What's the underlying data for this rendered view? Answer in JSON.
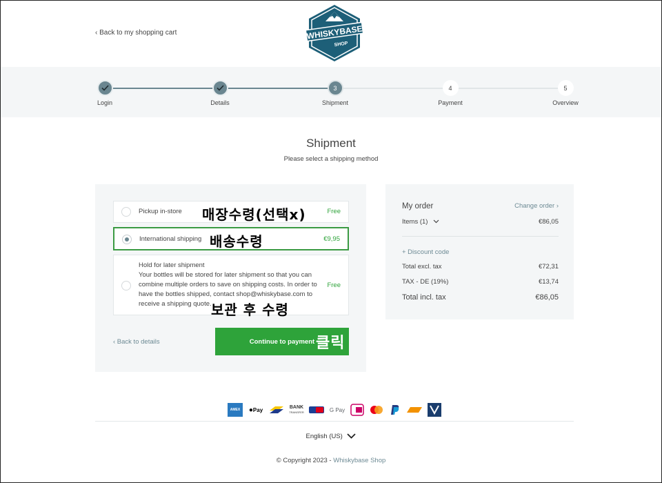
{
  "header": {
    "back_to_cart": "‹ Back to my shopping cart",
    "logo_text_main": "WHISKYBASE",
    "logo_text_sub": "SHOP"
  },
  "steps": [
    {
      "number": "",
      "label": "Login",
      "state": "done"
    },
    {
      "number": "",
      "label": "Details",
      "state": "done"
    },
    {
      "number": "3",
      "label": "Shipment",
      "state": "current"
    },
    {
      "number": "4",
      "label": "Payment",
      "state": "todo"
    },
    {
      "number": "5",
      "label": "Overview",
      "state": "todo"
    }
  ],
  "page": {
    "title": "Shipment",
    "subtitle": "Please select a shipping method"
  },
  "shipping_options": {
    "pickup": {
      "name": "Pickup in-store",
      "price": "Free",
      "selected": false
    },
    "international": {
      "name": "International shipping",
      "price": "€9,95",
      "selected": true
    },
    "hold": {
      "name": "Hold for later shipment",
      "description": "Your bottles will be stored for later shipment so that you can combine multiple orders to save on shipping costs. In order to have the bottles shipped, contact shop@whiskybase.com to receive a shipping quote.",
      "price": "Free",
      "selected": false
    }
  },
  "actions": {
    "back_to_details": "‹ Back to details",
    "continue": "Continue to payment"
  },
  "annotations": {
    "pickup": "매장수령(선택x)",
    "shipping": "배송수령",
    "hold": "보관 후 수령",
    "click": "클릭"
  },
  "order": {
    "heading": "My order",
    "change_link": "Change order ›",
    "items_label": "Items (1)",
    "items_value": "€86,05",
    "discount_link": "+ Discount code",
    "excl_label": "Total excl. tax",
    "excl_value": "€72,31",
    "tax_label": "TAX - DE (19%)",
    "tax_value": "€13,74",
    "incl_label": "Total incl. tax",
    "incl_value": "€86,05"
  },
  "payment_methods": [
    "amex-icon",
    "apple-pay-icon",
    "bancontact-icon",
    "bank-transfer-icon",
    "giropay-icon",
    "google-pay-icon",
    "ideal-icon",
    "mastercard-icon",
    "paypal-icon",
    "sofort-icon",
    "visa-icon"
  ],
  "payment_labels": {
    "applepay": "Pay",
    "gpay": "G Pay",
    "bank": "BANK",
    "bank_sub": "TRANSFER"
  },
  "footer": {
    "language": "English (US)",
    "copyright": "© Copyright 2023 - ",
    "brand": "Whiskybase Shop"
  },
  "colors": {
    "accent_green": "#2ea33a",
    "step_color": "#6a8690",
    "link_color": "#6d8a94",
    "panel_bg": "#f4f6f7"
  }
}
